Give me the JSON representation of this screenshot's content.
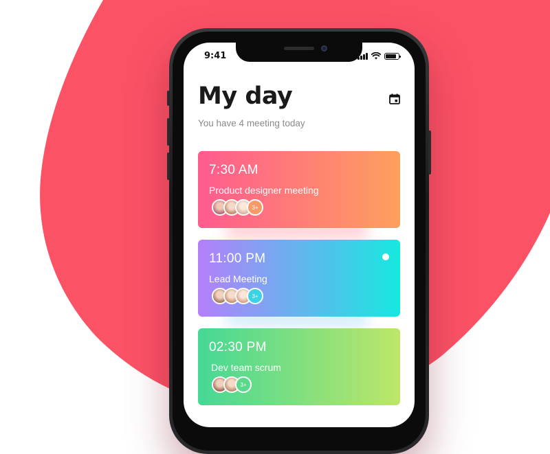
{
  "status_bar": {
    "time": "9:41"
  },
  "header": {
    "title": "My day",
    "subtitle": "You have 4 meeting today",
    "calendar_icon": "calendar-icon"
  },
  "colors": {
    "background_blob": "#fb5266",
    "card1": [
      "#fe5b8f",
      "#fda05e"
    ],
    "card2": [
      "#b57ffb",
      "#15e9e0"
    ],
    "card3": [
      "#45d895",
      "#bde66a"
    ]
  },
  "meetings": [
    {
      "time": "7:30 AM",
      "title": "Product designer meeting",
      "more_label": "3+",
      "more_color": "#f79a68"
    },
    {
      "time": "11:00 PM",
      "title": "Lead Meeting",
      "more_label": "3+",
      "more_color": "#3ad2e4"
    },
    {
      "time": "02:30 PM",
      "title": "Dev team scrum",
      "more_label": "3+",
      "more_color": "#5ad98a"
    }
  ]
}
